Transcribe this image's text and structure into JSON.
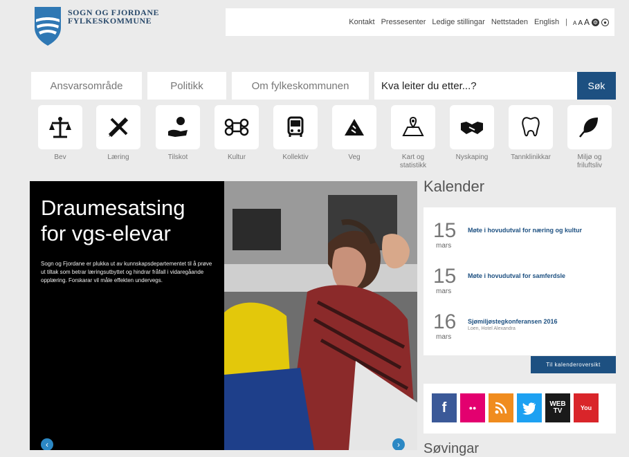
{
  "header": {
    "logo_line1": "SOGN OG FJORDANE",
    "logo_line2": "FYLKESKOMMUNE",
    "nav_links": [
      "Kontakt",
      "Pressesenter",
      "Ledige stillingar",
      "Nettstaden",
      "English"
    ],
    "separator": "|",
    "text_size_label": "A",
    "circle_dark": "⚙",
    "circle_light": "●"
  },
  "menu": {
    "items": [
      "Ansvarsområde",
      "Politikk",
      "Om fylkeskommunen"
    ],
    "search_placeholder": "Kva leiter du etter...?",
    "search_button": "Søk"
  },
  "categories": [
    {
      "label": "Bev",
      "icon": "scale-icon"
    },
    {
      "label": "Læring",
      "icon": "pencil-ruler-icon"
    },
    {
      "label": "Tilskot",
      "icon": "money-hand-icon"
    },
    {
      "label": "Kultur",
      "icon": "command-key-icon"
    },
    {
      "label": "Kollektiv",
      "icon": "bus-icon"
    },
    {
      "label": "Veg",
      "icon": "road-icon"
    },
    {
      "label": "Kart og statistikk",
      "icon": "map-icon"
    },
    {
      "label": "Nyskaping",
      "icon": "handshake-icon"
    },
    {
      "label": "Tannklinikkar",
      "icon": "tooth-icon"
    },
    {
      "label": "Miljø og friluftsliv",
      "icon": "leaf-icon"
    }
  ],
  "hero": {
    "title": "Draumesatsing for vgs-elevar",
    "body": "Sogn og Fjordane er plukka ut av kunnskapsdepartementet til å prøve ut tiltak som betrar læringsutbyttet og hindrar fråfall i vidaregåande opplæring. Forskarar vil måle effekten undervegs.",
    "prev": "‹",
    "next": "›"
  },
  "calendar": {
    "heading": "Kalender",
    "events": [
      {
        "day": "15",
        "month": "mars",
        "title": "Møte i hovudutval for næring og kultur",
        "sub": ""
      },
      {
        "day": "15",
        "month": "mars",
        "title": "Møte i hovudutval for samferdsle",
        "sub": ""
      },
      {
        "day": "16",
        "month": "mars",
        "title": "Sjømiljøstegkonferansen 2016",
        "sub": "Loen, Hotel Alexandra"
      }
    ],
    "button": "Til kalenderoversikt"
  },
  "social": {
    "facebook": "f",
    "flickr": "●●",
    "rss": "rss",
    "twitter": "t",
    "webtv_line1": "WEB",
    "webtv_line2": "TV",
    "youtube": "You"
  },
  "bottom_heading": "Søvingar",
  "colors": {
    "brand_blue": "#1d5081",
    "facebook": "#3b5998",
    "flickr": "#e3006f",
    "rss": "#f08c1e",
    "twitter": "#1da1f2",
    "webtv": "#1a1a1a",
    "youtube": "#d9252a"
  }
}
